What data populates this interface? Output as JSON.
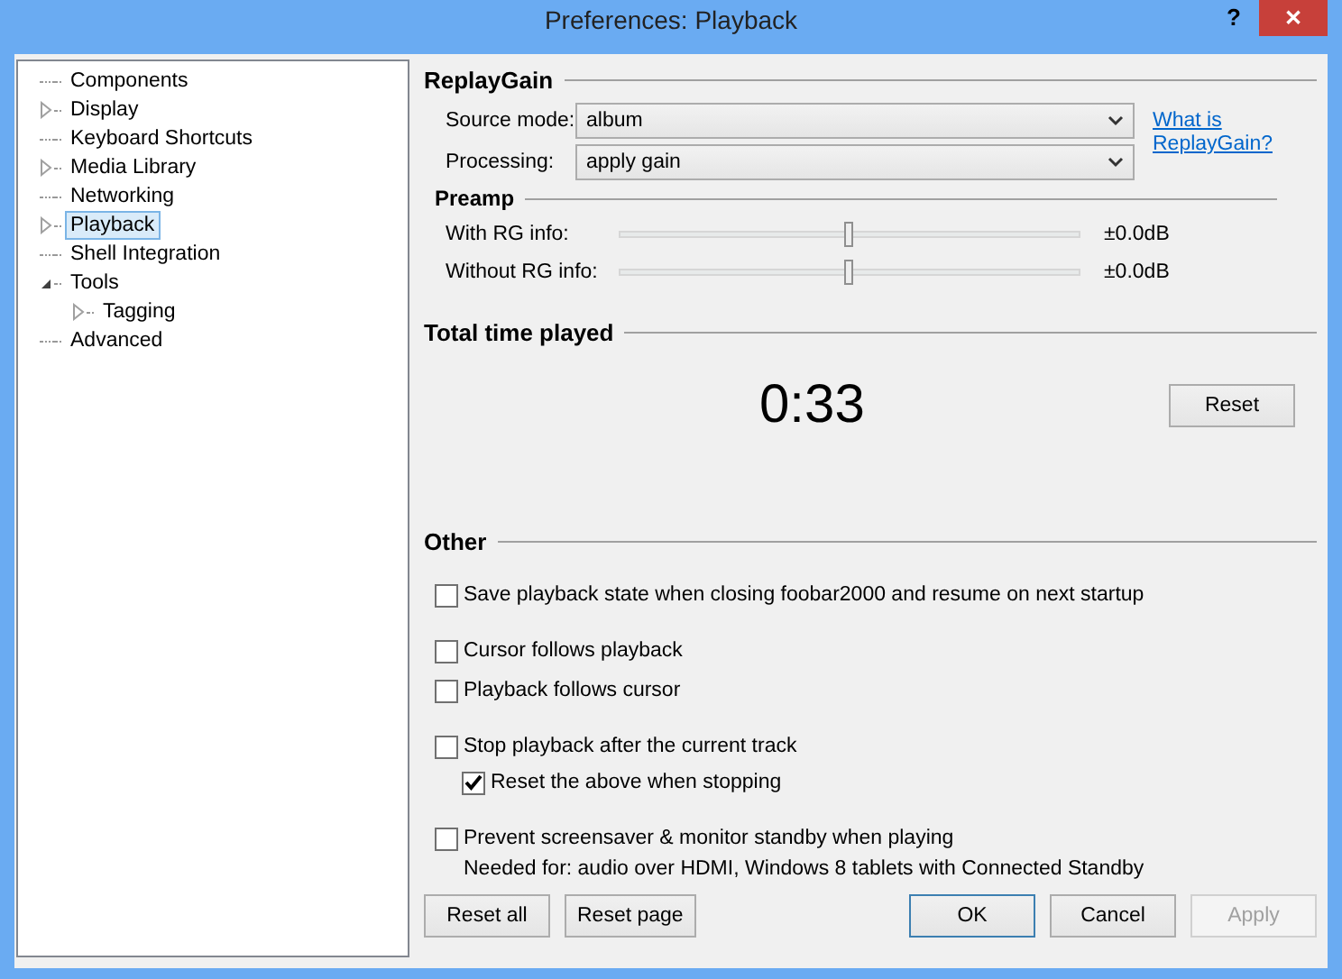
{
  "window": {
    "title": "Preferences: Playback",
    "help": "?",
    "close": "✕"
  },
  "tree": [
    {
      "label": "Components",
      "kind": "leaf",
      "selected": false
    },
    {
      "label": "Display",
      "kind": "collapsed",
      "selected": false
    },
    {
      "label": "Keyboard Shortcuts",
      "kind": "leaf",
      "selected": false
    },
    {
      "label": "Media Library",
      "kind": "collapsed",
      "selected": false
    },
    {
      "label": "Networking",
      "kind": "leaf",
      "selected": false
    },
    {
      "label": "Playback",
      "kind": "collapsed",
      "selected": true
    },
    {
      "label": "Shell Integration",
      "kind": "leaf",
      "selected": false
    },
    {
      "label": "Tools",
      "kind": "expanded",
      "selected": false,
      "children": [
        {
          "label": "Tagging",
          "kind": "collapsed",
          "selected": false
        }
      ]
    },
    {
      "label": "Advanced",
      "kind": "leaf",
      "selected": false
    }
  ],
  "replaygain": {
    "heading": "ReplayGain",
    "fields": [
      {
        "label": "Source mode:",
        "value": "album"
      },
      {
        "label": "Processing:",
        "value": "apply gain"
      }
    ],
    "link": "What is ReplayGain?",
    "preamp": {
      "heading": "Preamp",
      "sliders": [
        {
          "label": "With RG info:",
          "level": 0.5,
          "reading": "±0.0dB"
        },
        {
          "label": "Without RG info:",
          "level": 0.5,
          "reading": "±0.0dB"
        }
      ]
    }
  },
  "time_played": {
    "heading": "Total time played",
    "value": "0:33",
    "button": "Reset"
  },
  "other": {
    "heading": "Other",
    "groups": [
      [
        {
          "label": "Save playback state when closing foobar2000 and resume on next startup",
          "checked": false
        }
      ],
      [
        {
          "label": "Cursor follows playback",
          "checked": false
        },
        {
          "label": "Playback follows cursor",
          "checked": false
        }
      ],
      [
        {
          "label": "Stop playback after the current track",
          "checked": false,
          "children": [
            {
              "label": "Reset the above when stopping",
              "checked": true
            }
          ]
        }
      ],
      [
        {
          "label": "Prevent screensaver & monitor standby when playing",
          "checked": false
        }
      ]
    ],
    "note": "Needed for: audio over HDMI, Windows 8 tablets with Connected Standby"
  },
  "buttons": [
    {
      "label": "Reset all",
      "kind": "normal"
    },
    {
      "label": "Reset page",
      "kind": "normal"
    },
    {
      "label": "OK",
      "kind": "default"
    },
    {
      "label": "Cancel",
      "kind": "normal"
    },
    {
      "label": "Apply",
      "kind": "disabled"
    }
  ]
}
